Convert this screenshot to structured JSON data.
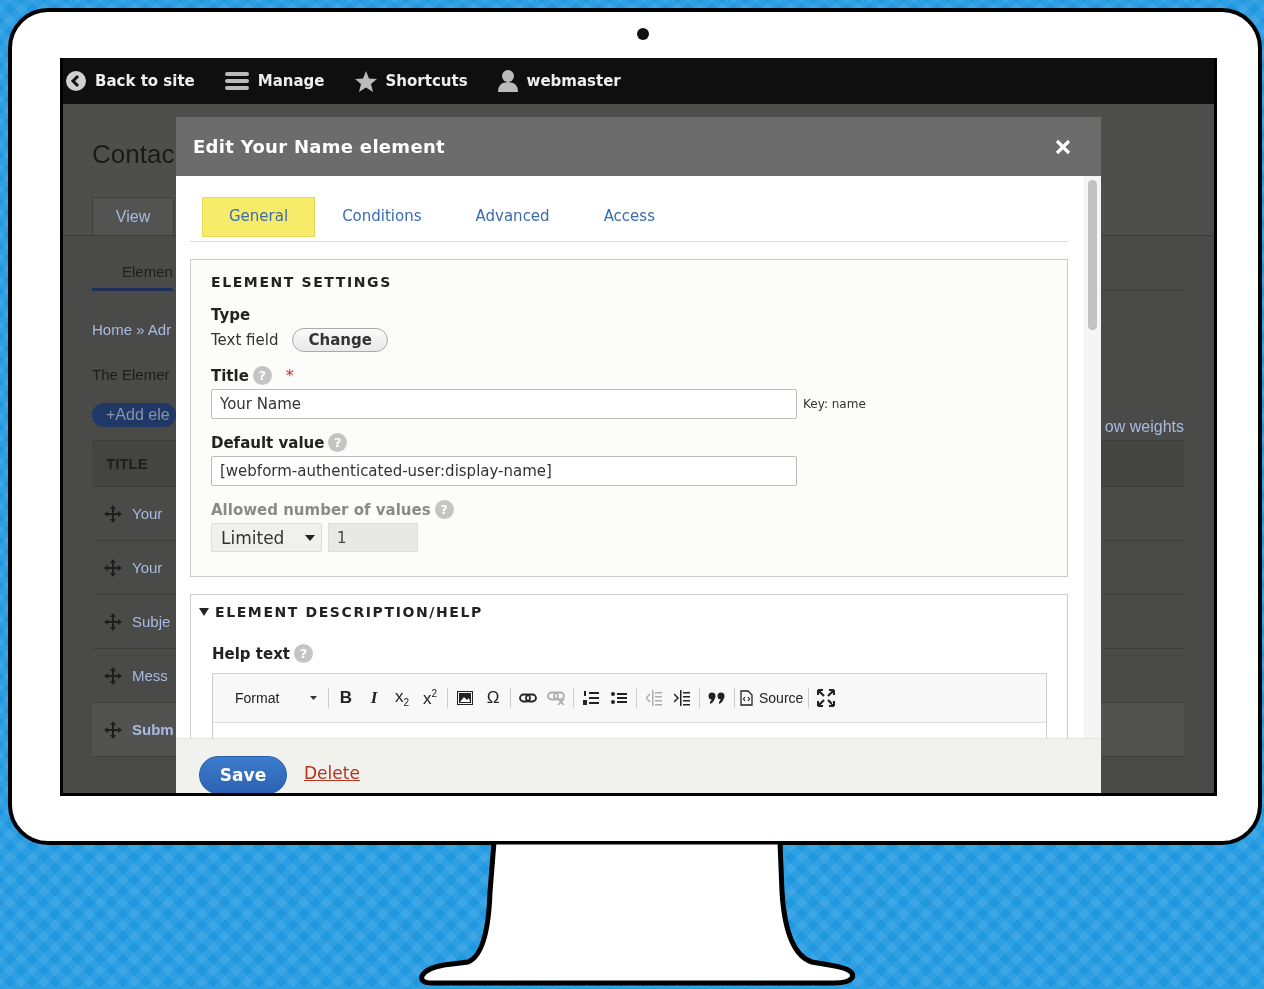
{
  "topbar": {
    "items": [
      {
        "kind": "back",
        "label": "Back to site"
      },
      {
        "kind": "menu",
        "label": "Manage"
      },
      {
        "kind": "star",
        "label": "Shortcuts"
      },
      {
        "kind": "user",
        "label": "webmaster"
      }
    ]
  },
  "page": {
    "title": "Contac",
    "tabs": [
      {
        "label": "View",
        "selected": false
      }
    ],
    "subtabs": [
      {
        "label": "Elemen",
        "selected": true
      }
    ],
    "breadcrumb": "Home » Adr",
    "description": "The Elemer",
    "add_button": "+Add ele",
    "weights_link": "ow weights",
    "table": {
      "columns": [
        "TITLE"
      ],
      "rows": [
        {
          "title": "Your",
          "highlighted": false
        },
        {
          "title": "Your",
          "highlighted": false
        },
        {
          "title": "Subje",
          "highlighted": false
        },
        {
          "title": "Mess",
          "highlighted": false
        },
        {
          "title": "Subm",
          "highlighted": true
        }
      ]
    }
  },
  "dialog": {
    "title": "Edit Your Name element",
    "tabs": [
      {
        "label": "General",
        "selected": true
      },
      {
        "label": "Conditions",
        "selected": false
      },
      {
        "label": "Advanced",
        "selected": false
      },
      {
        "label": "Access",
        "selected": false
      }
    ],
    "settings": {
      "legend": "ELEMENT SETTINGS",
      "type_label": "Type",
      "type_value": "Text field",
      "change_button": "Change",
      "fields": [
        {
          "kind": "text",
          "label": "Title",
          "help": "?",
          "required_mark": "*",
          "value": "Your Name",
          "suffix": "Key: name",
          "disabled": false
        },
        {
          "kind": "text",
          "label": "Default value",
          "help": "?",
          "value": "[webform-authenticated-user:display-name]",
          "disabled": false
        },
        {
          "kind": "limit",
          "label": "Allowed number of values",
          "help": "?",
          "select": "Limited",
          "value": "1",
          "disabled": true
        }
      ]
    },
    "description_help": {
      "legend": "ELEMENT DESCRIPTION/HELP",
      "expanded": true,
      "help_label": "Help text",
      "help": "?",
      "toolbar": [
        [
          {
            "kind": "dropdown",
            "label": "Format",
            "disabled": false
          }
        ],
        [
          {
            "kind": "bold",
            "label": "B",
            "disabled": false
          },
          {
            "kind": "italic",
            "label": "I",
            "disabled": false
          },
          {
            "kind": "glyph",
            "label": "x$_{2}$",
            "disabled": false
          },
          {
            "kind": "glyph",
            "label": "x$^{2}$",
            "disabled": false
          }
        ],
        [
          {
            "kind": "image",
            "disabled": false
          },
          {
            "kind": "glyph",
            "label": "Ω",
            "disabled": false
          }
        ],
        [
          {
            "kind": "link",
            "disabled": false
          },
          {
            "kind": "unlink",
            "disabled": true
          }
        ],
        [
          {
            "kind": "numbered",
            "disabled": false
          },
          {
            "kind": "bulleted",
            "disabled": false
          }
        ],
        [
          {
            "kind": "outdent",
            "disabled": true
          },
          {
            "kind": "indent",
            "disabled": false
          }
        ],
        [
          {
            "kind": "quote",
            "disabled": false
          }
        ],
        [
          {
            "kind": "source",
            "label": "Source",
            "disabled": false
          }
        ],
        [
          {
            "kind": "maximize",
            "disabled": false
          }
        ]
      ]
    },
    "footer": {
      "save": "Save",
      "delete": "Delete"
    }
  }
}
